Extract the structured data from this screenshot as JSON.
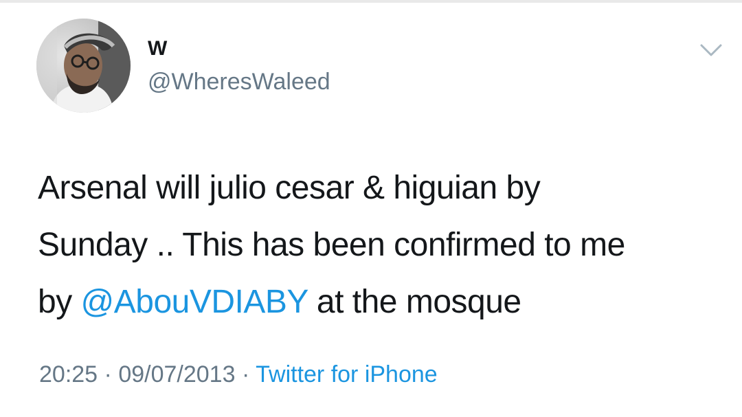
{
  "tweet": {
    "user": {
      "display_name": "W",
      "handle": "@WheresWaleed"
    },
    "text_segments": {
      "line1": "Arsenal will julio cesar & higuian by",
      "line2": "Sunday .. This has been confirmed to me",
      "line3_prefix": "by ",
      "mention": "@AbouVDIABY",
      "line3_suffix": " at the mosque"
    },
    "meta": {
      "time": "20:25",
      "separator": "·",
      "date": "09/07/2013",
      "source": "Twitter for iPhone"
    },
    "menu_icon": "chevron-down-icon"
  },
  "colors": {
    "text": "#14171a",
    "secondary": "#657786",
    "link": "#1b95e0",
    "background": "#ffffff"
  }
}
